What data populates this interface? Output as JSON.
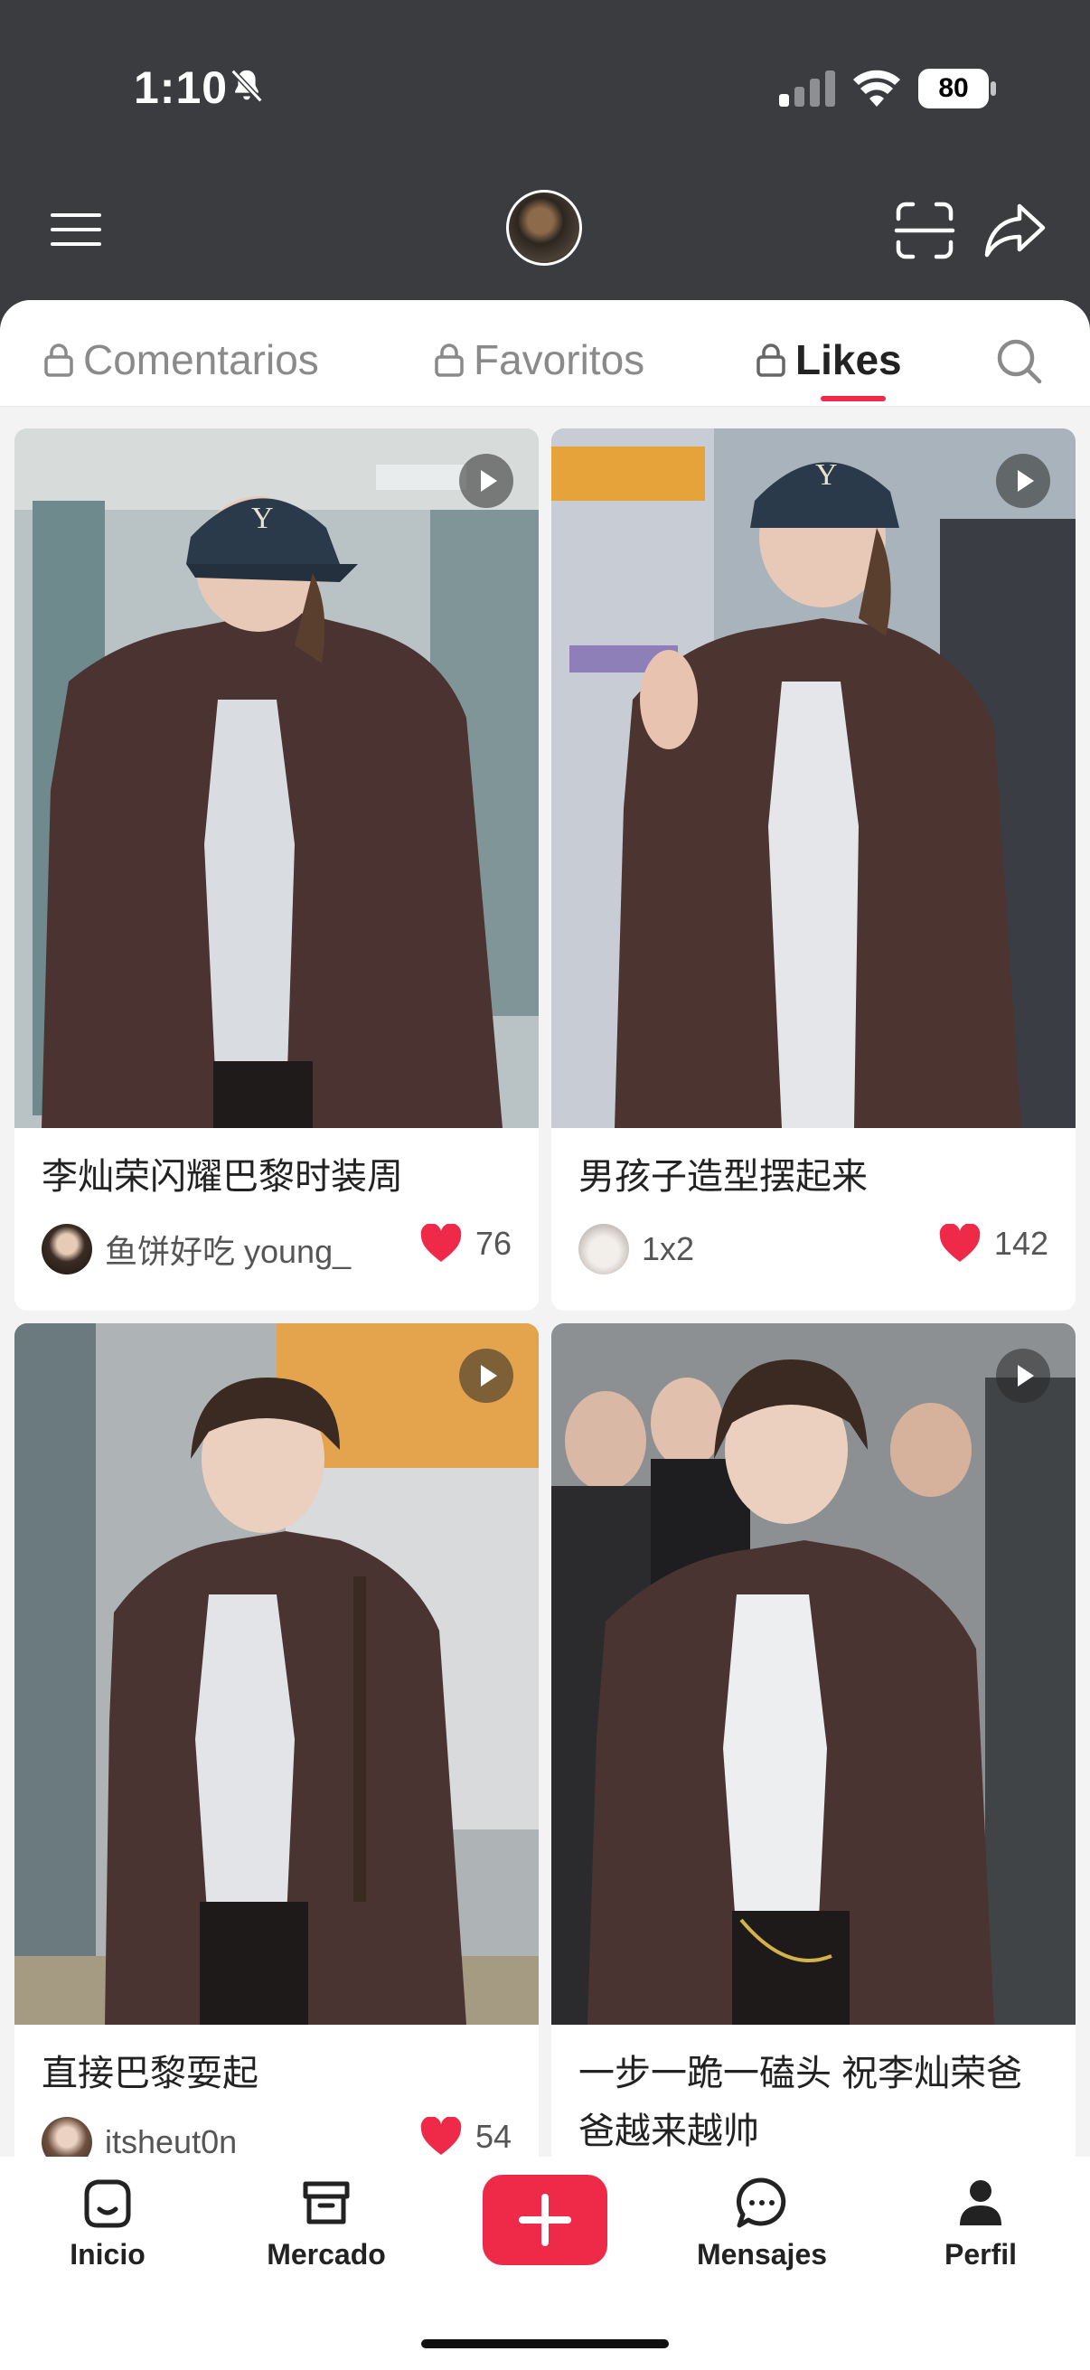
{
  "status_bar": {
    "time": "1:10",
    "battery": "80"
  },
  "tabs": [
    {
      "label": "Comentarios",
      "locked": true,
      "active": false
    },
    {
      "label": "Favoritos",
      "locked": true,
      "active": false
    },
    {
      "label": "Likes",
      "locked": true,
      "active": true
    }
  ],
  "cards": [
    {
      "title": "李灿荣闪耀巴黎时装周",
      "author": "鱼饼好吃 young_",
      "likes": "76",
      "video": true
    },
    {
      "title": "男孩子造型摆起来",
      "author": "1x2",
      "likes": "142",
      "video": true
    },
    {
      "title": "直接巴黎耍起",
      "author": "itsheut0n_",
      "likes": "54",
      "video": true
    },
    {
      "title": "一步一跪一磕头 祝李灿荣爸爸越来越帅",
      "video": true
    }
  ],
  "bottom_nav": {
    "home": "Inicio",
    "market": "Mercado",
    "messages": "Mensajes",
    "profile": "Perfil"
  },
  "colors": {
    "accent": "#ee2a48",
    "header_bg": "#3a3c40",
    "sheet_bg": "#f3f3f3"
  }
}
